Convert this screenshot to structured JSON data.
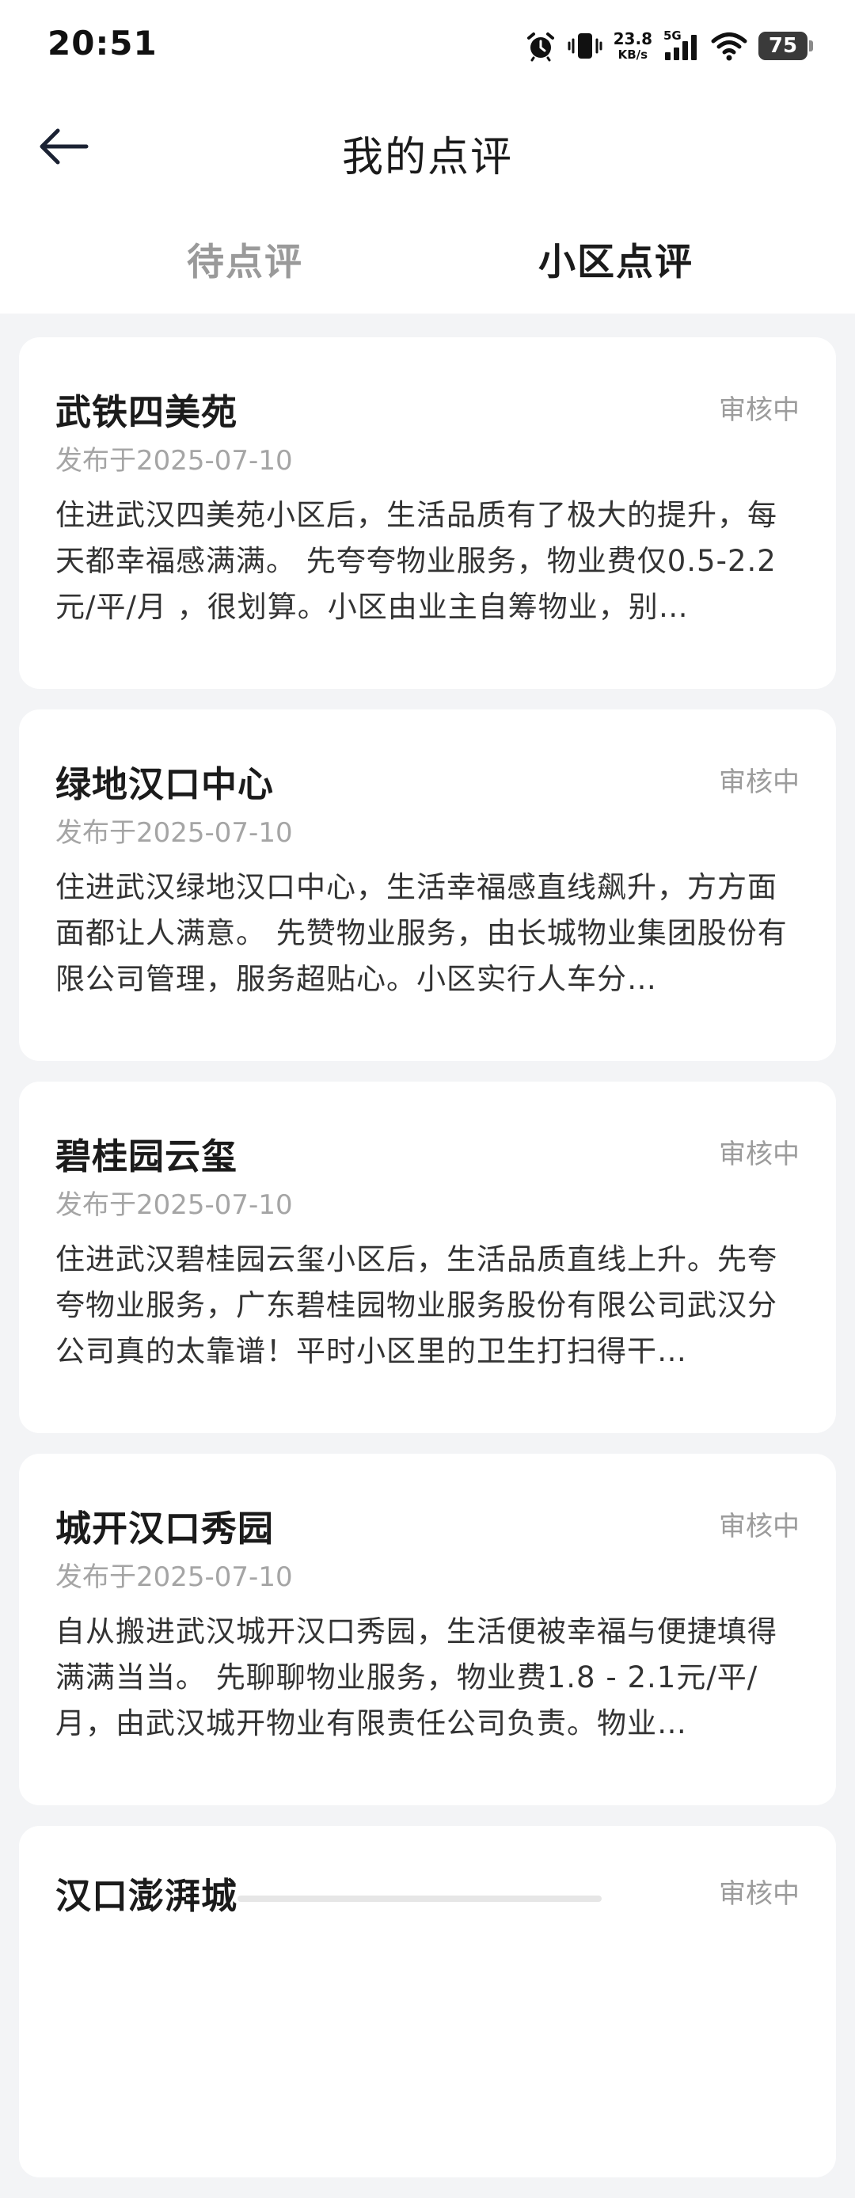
{
  "status_bar": {
    "time": "20:51",
    "net_speed_value": "23.8",
    "net_speed_unit": "KB/s",
    "network_type": "5G",
    "battery": "75"
  },
  "header": {
    "title": "我的点评"
  },
  "tabs": [
    {
      "label": "待点评",
      "active": false
    },
    {
      "label": "小区点评",
      "active": true
    }
  ],
  "reviews": [
    {
      "title": "武铁四美苑",
      "status": "审核中",
      "date": "发布于2025-07-10",
      "body": "住进武汉四美苑小区后，生活品质有了极大的提升，每天都幸福感满满。  先夸夸物业服务，物业费仅0.5-2.2元/平/月 ，很划算。小区由业主自筹物业，别…"
    },
    {
      "title": "绿地汉口中心",
      "status": "审核中",
      "date": "发布于2025-07-10",
      "body": "住进武汉绿地汉口中心，生活幸福感直线飙升，方方面面都让人满意。  先赞物业服务，由长城物业集团股份有限公司管理，服务超贴心。小区实行人车分…"
    },
    {
      "title": "碧桂园云玺",
      "status": "审核中",
      "date": "发布于2025-07-10",
      "body": "住进武汉碧桂园云玺小区后，生活品质直线上升。先夸夸物业服务，广东碧桂园物业服务股份有限公司武汉分公司真的太靠谱！平时小区里的卫生打扫得干…"
    },
    {
      "title": "城开汉口秀园",
      "status": "审核中",
      "date": "发布于2025-07-10",
      "body": "自从搬进武汉城开汉口秀园，生活便被幸福与便捷填得满满当当。  先聊聊物业服务，物业费1.8 - 2.1元/平/月，由武汉城开物业有限责任公司负责。物业…"
    },
    {
      "title": "汉口澎湃城",
      "status": "审核中",
      "date": "",
      "body": ""
    }
  ]
}
